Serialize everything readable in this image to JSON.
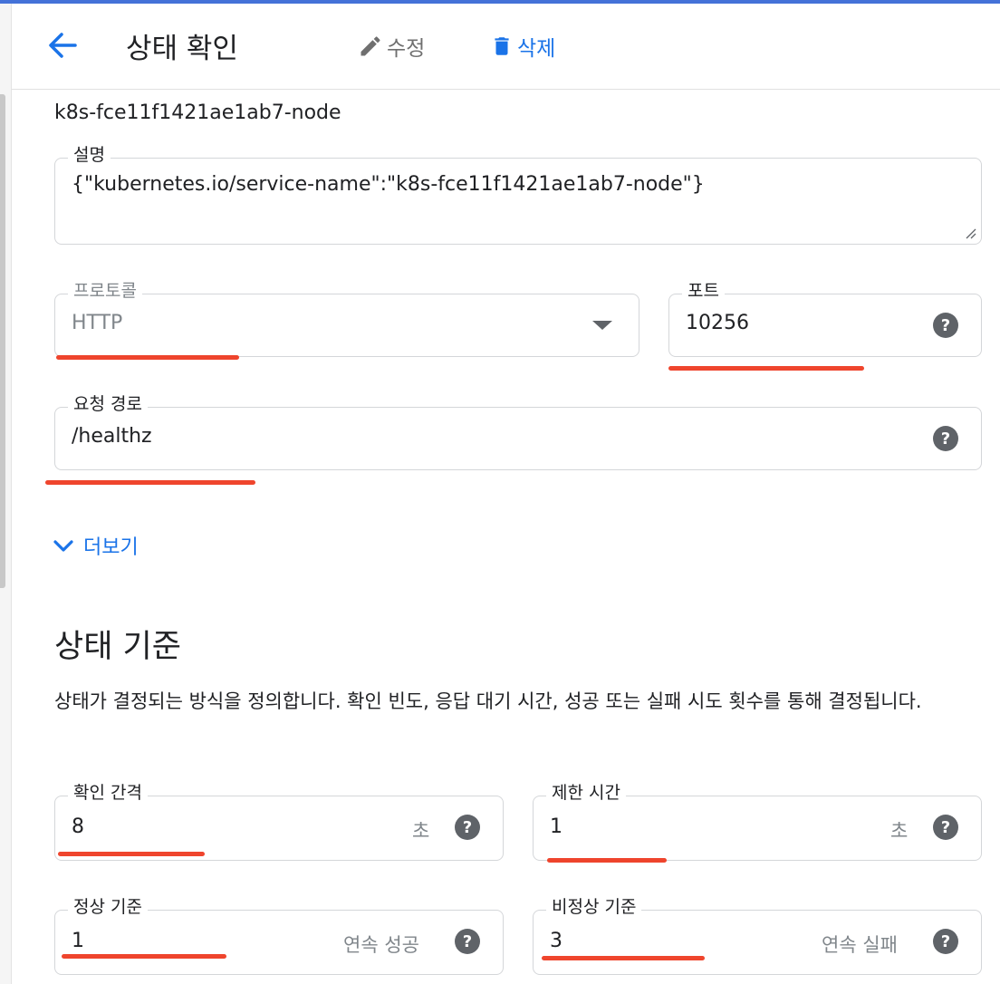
{
  "header": {
    "title": "상태 확인",
    "edit_label": "수정",
    "delete_label": "삭제"
  },
  "name": "k8s-fce11f1421ae1ab7-node",
  "description_field": {
    "label": "설명",
    "value": "{\"kubernetes.io/service-name\":\"k8s-fce11f1421ae1ab7-node\"}"
  },
  "protocol_field": {
    "label": "프로토콜",
    "value": "HTTP"
  },
  "port_field": {
    "label": "포트",
    "value": "10256"
  },
  "path_field": {
    "label": "요청 경로",
    "value": "/healthz"
  },
  "more_link": "더보기",
  "criteria": {
    "title": "상태 기준",
    "description": "상태가 결정되는 방식을 정의합니다. 확인 빈도, 응답 대기 시간, 성공 또는 실패 시도 횟수를 통해 결정됩니다.",
    "check_interval": {
      "label": "확인 간격",
      "value": "8",
      "suffix": "초"
    },
    "timeout": {
      "label": "제한 시간",
      "value": "1",
      "suffix": "초"
    },
    "healthy_threshold": {
      "label": "정상 기준",
      "value": "1",
      "suffix": "연속 성공"
    },
    "unhealthy_threshold": {
      "label": "비정상 기준",
      "value": "3",
      "suffix": "연속 실패"
    }
  },
  "colors": {
    "accent": "#1a73e8",
    "annotation": "#ee3b22",
    "topbar": "#4472d8"
  }
}
